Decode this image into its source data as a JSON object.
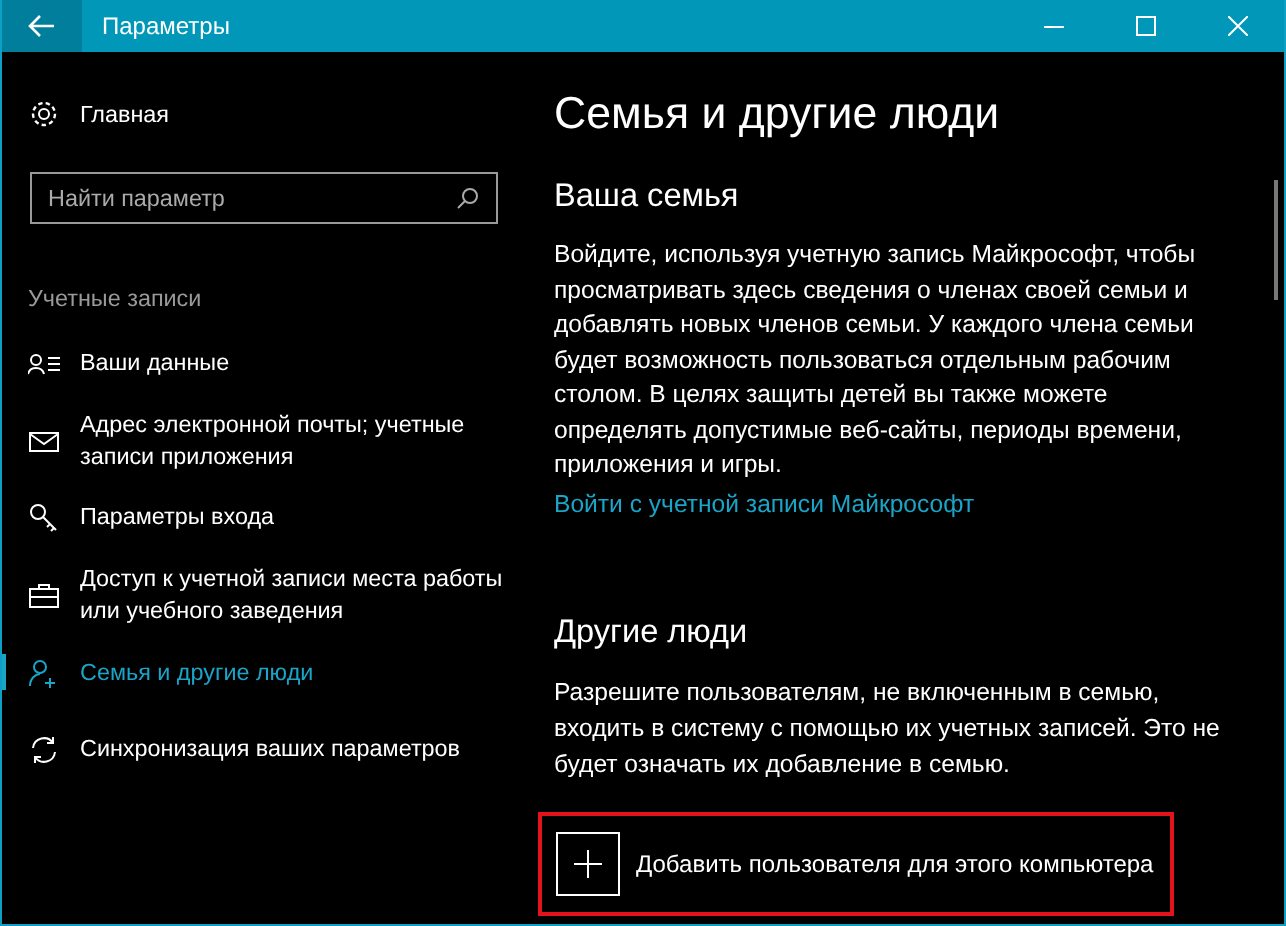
{
  "window": {
    "title": "Параметры"
  },
  "sidebar": {
    "home": "Главная",
    "search": {
      "placeholder": "Найти параметр"
    },
    "section": "Учетные записи",
    "items": [
      {
        "label": "Ваши данные",
        "selected": false
      },
      {
        "label": "Адрес электронной почты; учетные записи приложения",
        "selected": false
      },
      {
        "label": "Параметры входа",
        "selected": false
      },
      {
        "label": "Доступ к учетной записи места работы или учебного заведения",
        "selected": false
      },
      {
        "label": "Семья и другие люди",
        "selected": true
      },
      {
        "label": "Синхронизация ваших параметров",
        "selected": false
      }
    ]
  },
  "content": {
    "title": "Семья и другие люди",
    "family": {
      "heading": "Ваша семья",
      "text": "Войдите, используя учетную запись Майкрософт, чтобы просматривать здесь сведения о членах своей семьи и добавлять новых членов семьи. У каждого члена семьи будет возможность пользоваться отдельным рабочим столом. В целях защиты детей вы также можете определять допустимые веб-сайты, периоды времени, приложения и игры.",
      "link": "Войти с учетной записи Майкрософт"
    },
    "others": {
      "heading": "Другие люди",
      "text": "Разрешите пользователям, не включенным в семью, входить в систему с помощью их учетных записей. Это не будет означать их добавление в семью.",
      "add_button": "Добавить пользователя для этого компьютера"
    }
  }
}
